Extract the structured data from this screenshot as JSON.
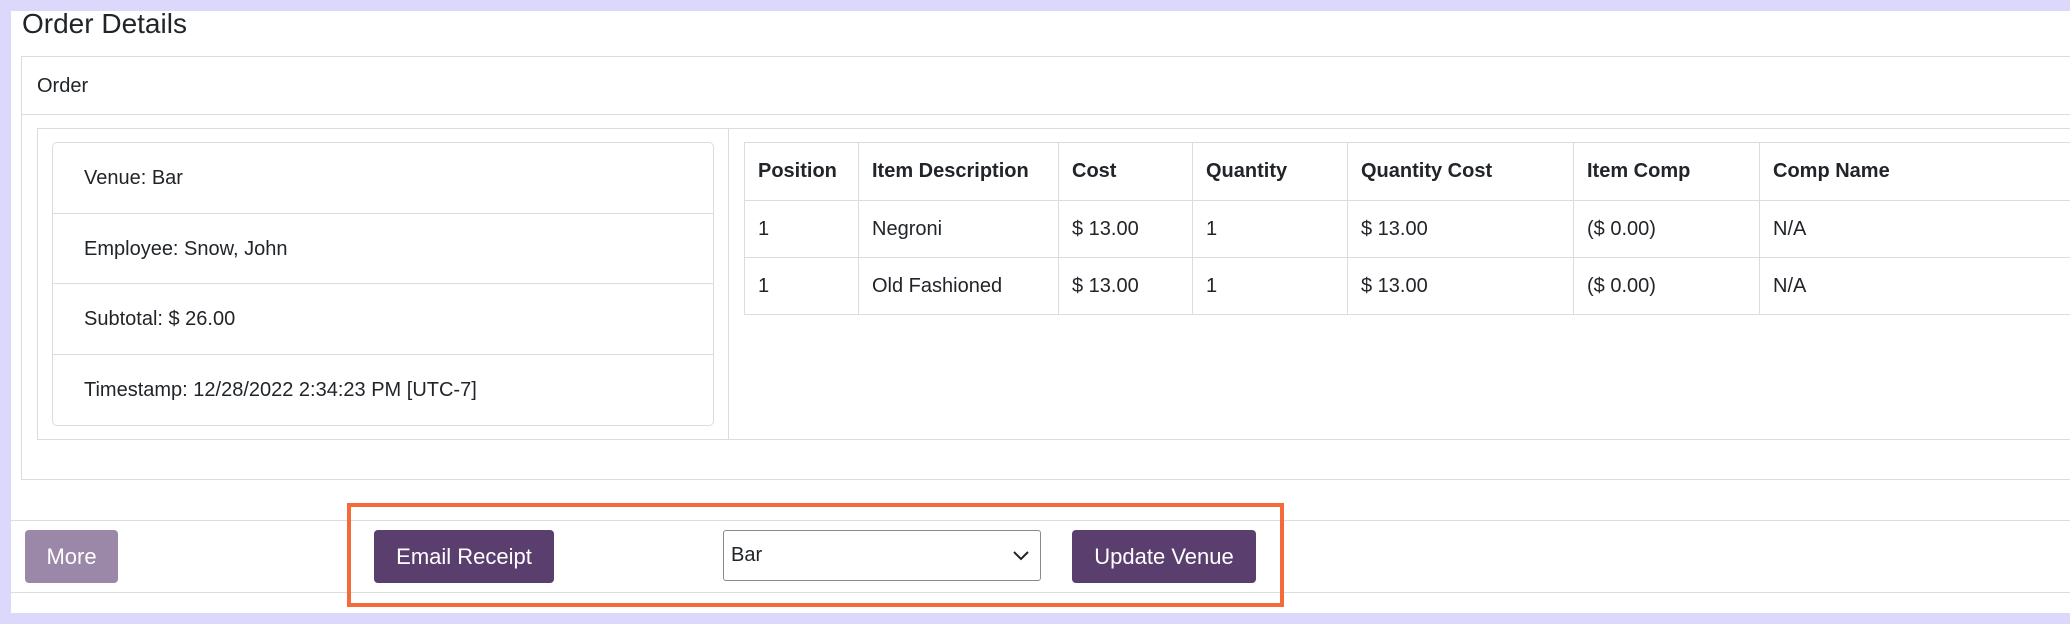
{
  "page": {
    "title": "Order Details"
  },
  "card": {
    "header": "Order"
  },
  "info": {
    "venue": "Venue: Bar",
    "employee": "Employee: Snow, John",
    "subtotal": "Subtotal: $ 26.00",
    "timestamp": "Timestamp: 12/28/2022 2:34:23 PM [UTC-7]"
  },
  "table": {
    "headers": [
      "Position",
      "Item Description",
      "Cost",
      "Quantity",
      "Quantity Cost",
      "Item Comp",
      "Comp Name"
    ],
    "rows": [
      [
        "1",
        "Negroni",
        "$ 13.00",
        "1",
        "$ 13.00",
        "($ 0.00)",
        "N/A"
      ],
      [
        "1",
        "Old Fashioned",
        "$ 13.00",
        "1",
        "$ 13.00",
        "($ 0.00)",
        "N/A"
      ]
    ]
  },
  "footer": {
    "more_label": "More",
    "email_label": "Email Receipt",
    "venue_select_value": "Bar",
    "update_label": "Update Venue"
  },
  "colors": {
    "accent": "#5a3e6e",
    "accent_disabled": "#9b87a8",
    "highlight": "#f46a3b",
    "frame": "#dcd8fb"
  },
  "icons": {
    "select_arrow": "chevron-down-icon"
  }
}
